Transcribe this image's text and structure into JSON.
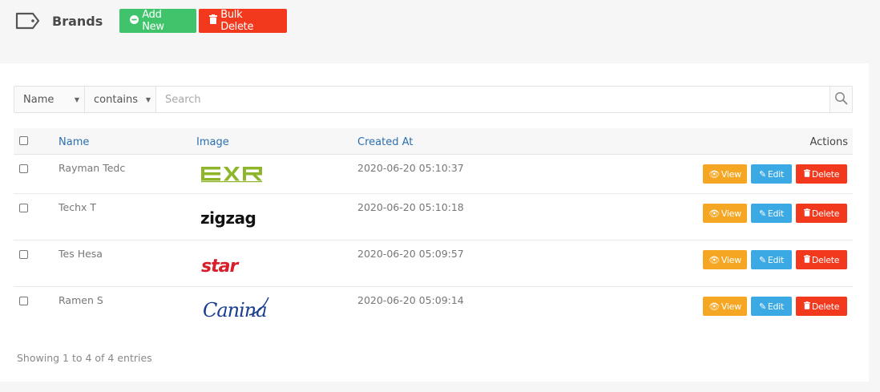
{
  "header": {
    "title": "Brands",
    "add_label": "Add New",
    "bulk_label": "Bulk Delete"
  },
  "filter": {
    "field": "Name",
    "operator": "contains",
    "placeholder": "Search"
  },
  "table": {
    "columns": {
      "name": "Name",
      "image": "Image",
      "created_at": "Created At",
      "actions": "Actions"
    },
    "rows": [
      {
        "name": "Rayman Tedc",
        "created_at": "2020-06-20 05:10:37",
        "logo": "exr-logo"
      },
      {
        "name": "Techx T",
        "created_at": "2020-06-20 05:10:18",
        "logo": "zigzag-logo"
      },
      {
        "name": "Tes Hesa",
        "created_at": "2020-06-20 05:09:57",
        "logo": "star-logo"
      },
      {
        "name": "Ramen S",
        "created_at": "2020-06-20 05:09:14",
        "logo": "canina-logo"
      }
    ],
    "action_labels": {
      "view": "View",
      "edit": "Edit",
      "delete": "Delete"
    }
  },
  "footer": {
    "summary": "Showing 1 to 4 of 4 entries"
  },
  "colors": {
    "add": "#3fc36b",
    "delete": "#f2391e",
    "view": "#f5a623",
    "edit": "#3ba9e4",
    "link": "#2b6fb0"
  }
}
